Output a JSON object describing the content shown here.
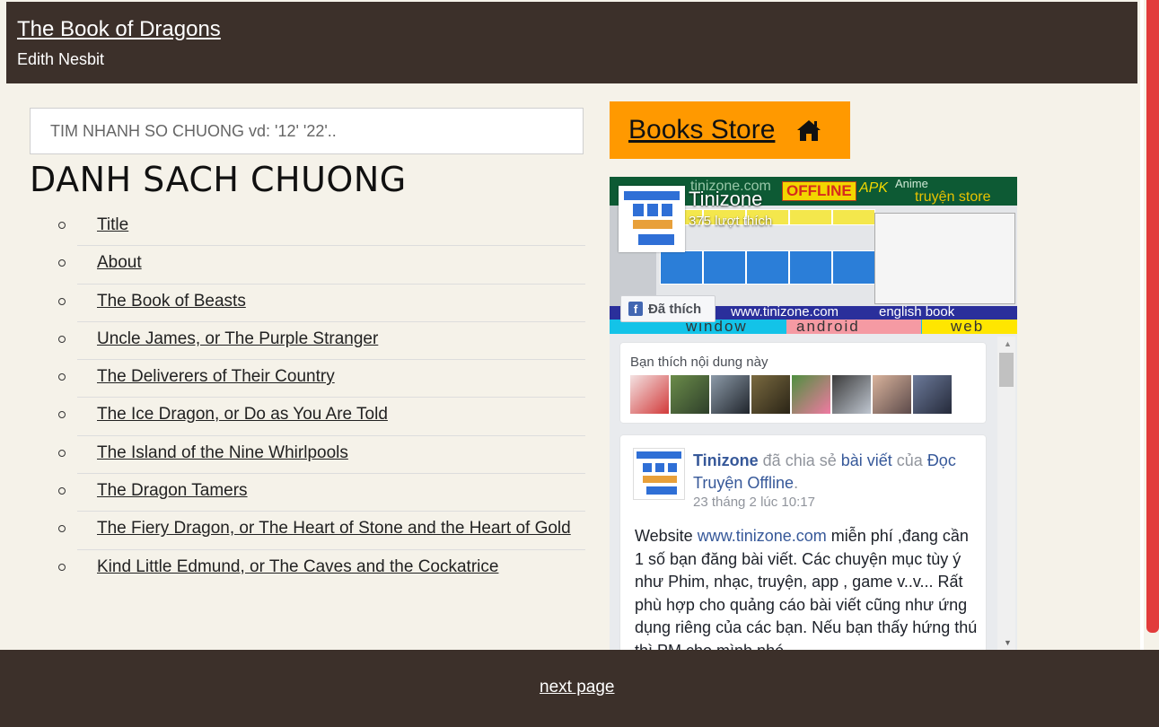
{
  "header": {
    "title": "The Book of Dragons",
    "author": "Edith Nesbit"
  },
  "search": {
    "placeholder": "TIM NHANH SO CHUONG vd: '12' '22'.."
  },
  "chapter_list": {
    "heading": "DANH SACH CHUONG",
    "items": [
      "Title",
      "About",
      "The Book of Beasts",
      "Uncle James, or The Purple Stranger",
      "The Deliverers of Their Country",
      "The Ice Dragon, or Do as You Are Told",
      "The Island of the Nine Whirlpools",
      "The Dragon Tamers",
      "The Fiery Dragon, or The Heart of Stone and the Heart of Gold",
      "Kind Little Edmund, or The Caves and the Cockatrice"
    ]
  },
  "books_store": {
    "label": "Books Store",
    "icon": "home-icon",
    "color": "#ff9900"
  },
  "fb_widget": {
    "cover": {
      "brand": "tinizone.com",
      "offline": "OFFLINE",
      "apk": "APK",
      "anime": "Anime",
      "store": "truyện store",
      "url": "www.tinizone.com",
      "english": "english book",
      "window": "window",
      "android": "android",
      "web": "web"
    },
    "page_name": "Tinizone",
    "page_likes": "375 lượt thích",
    "liked_button": "Đã thích",
    "friends_label": "Bạn thích nội dung này",
    "post": {
      "author": "Tinizone",
      "shared_text": " đã chia sẻ ",
      "post_link": "bài viết",
      "of_text": " của ",
      "source": "Đọc Truyện Offline",
      "period": ".",
      "time": "23 tháng 2 lúc 10:17",
      "body_prefix": "Website ",
      "body_link": "www.tinizone.com",
      "body_rest": " miễn phí ,đang cần 1 số bạn đăng bài viết. Các chuyện mục tùy ý như Phim, nhạc, truyện, app , game v..v... Rất phù hợp cho quảng cáo bài viết cũng như ứng dụng riêng của các bạn. Nếu bạn thấy hứng thú thì PM cho mình nhé."
    }
  },
  "footer": {
    "next_label": "next page"
  }
}
